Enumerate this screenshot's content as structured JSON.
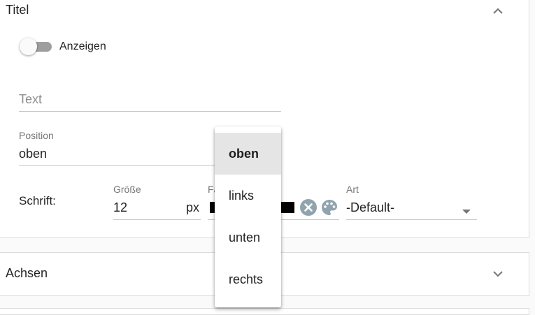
{
  "title_panel": {
    "heading": "Titel",
    "toggle_label": "Anzeigen",
    "toggle_on": false,
    "text_field": {
      "placeholder": "Text",
      "value": ""
    },
    "position_field": {
      "label": "Position",
      "value": "oben"
    },
    "font_row": {
      "label": "Schrift:",
      "size": {
        "label": "Größe",
        "value": "12",
        "unit": "px"
      },
      "color": {
        "label": "Fa",
        "value": "#000000"
      },
      "style": {
        "label": "Art",
        "value": "-Default-"
      }
    }
  },
  "axes_panel": {
    "heading": "Achsen"
  },
  "position_menu": {
    "options": [
      "oben",
      "links",
      "unten",
      "rechts"
    ],
    "selected": "oben"
  },
  "icons": {
    "collapse": "chevron-up-icon",
    "expand": "chevron-down-icon",
    "clear": "clear-circle-icon",
    "palette": "palette-icon",
    "dropdown": "dropdown-arrow-icon"
  },
  "colors": {
    "clear_icon": "#90a4ae",
    "toggle_track": "#9e9e9e"
  }
}
